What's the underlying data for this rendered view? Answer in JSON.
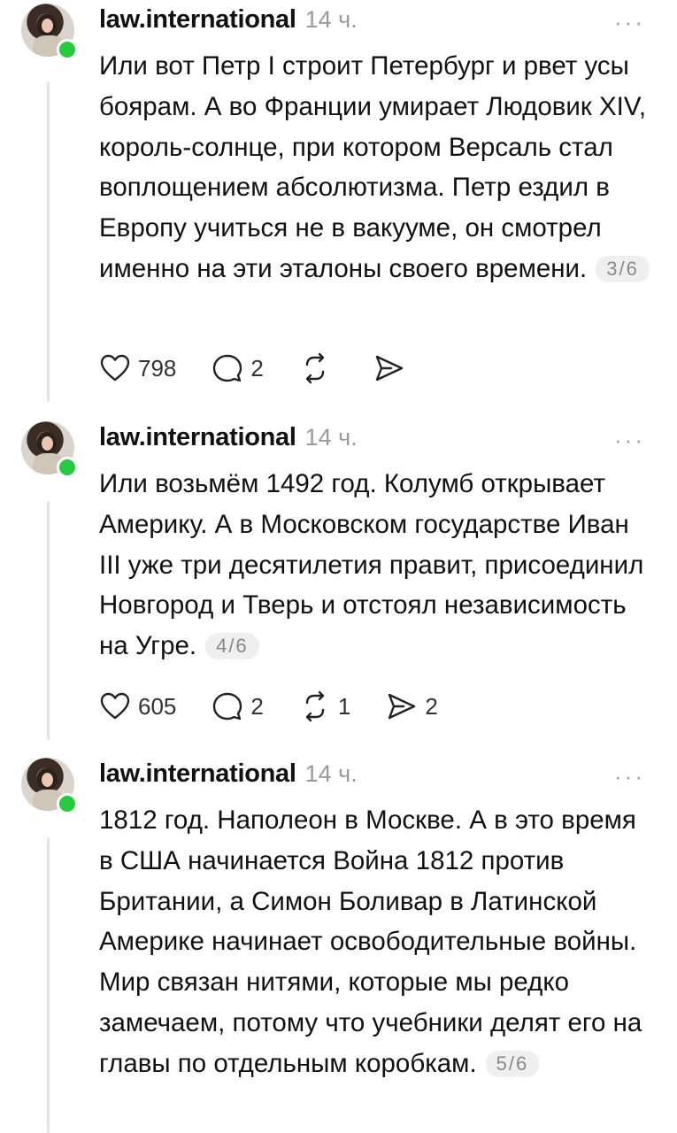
{
  "posts": [
    {
      "username": "law.international",
      "time": "14 ч.",
      "more": "···",
      "text": "Или вот Петр I строит Петербург и рвет усы боярам. А во Франции умирает Людовик XIV, король-солнце, при котором Версаль стал воплощением абсолютизма. Петр ездил в Европу учиться не в вакууме, он смотрел именно на эти эталоны своего времени.",
      "counter": "3/6",
      "likes": "798",
      "replies": "2",
      "reposts": "",
      "shares": ""
    },
    {
      "username": "law.international",
      "time": "14 ч.",
      "more": "···",
      "text": "Или возьмём 1492 год. Колумб открывает Америку. А в Московском государстве Иван III уже три десятилетия правит, присоединил Новгород и Тверь и отстоял независимость на Угре.",
      "counter": "4/6",
      "likes": "605",
      "replies": "2",
      "reposts": "1",
      "shares": "2"
    },
    {
      "username": "law.international",
      "time": "14 ч.",
      "more": "···",
      "text": "1812 год. Наполеон в Москве. А в это время в США начинается Война 1812 против Британии, а Симон Боливар в Латинской Америке начинает освободительные войны. Мир связан нитями, которые мы редко замечаем, потому что учебники делят его на главы по отдельным коробкам.",
      "counter": "5/6"
    }
  ],
  "icons": {
    "like": "heart-icon",
    "reply": "comment-icon",
    "repost": "repost-icon",
    "share": "send-icon"
  },
  "colors": {
    "online": "#27c93f",
    "meta": "#9a9a9a",
    "thread_line": "#e4e4e4"
  }
}
